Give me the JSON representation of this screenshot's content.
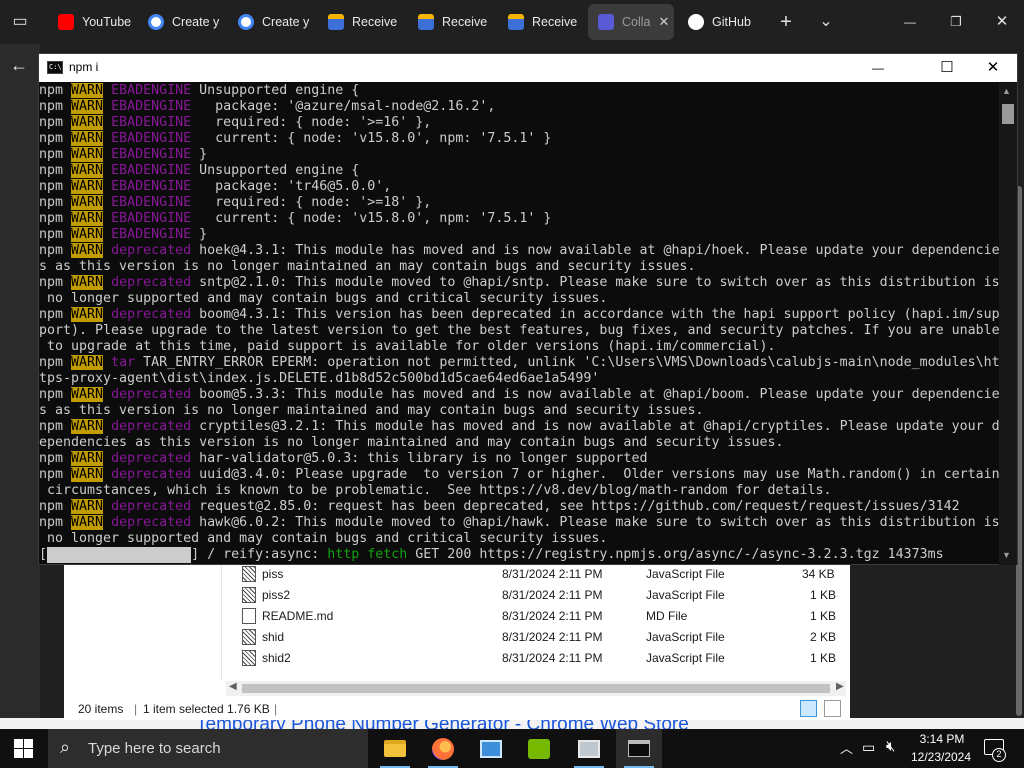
{
  "browser": {
    "tabs": [
      {
        "label": "YouTube",
        "icon": "youtube-icon"
      },
      {
        "label": "Create y",
        "icon": "google-icon"
      },
      {
        "label": "Create y",
        "icon": "google-icon"
      },
      {
        "label": "Receive",
        "icon": "receive-icon"
      },
      {
        "label": "Receive",
        "icon": "receive-icon"
      },
      {
        "label": "Receive",
        "icon": "receive-icon"
      },
      {
        "label": "Colla",
        "icon": "collab-icon",
        "active": true
      },
      {
        "label": "GitHub",
        "icon": "github-icon"
      }
    ],
    "new_tab_glyph": "+",
    "tab_list_glyph": "⌄",
    "minimize_glyph": "—",
    "restore_glyph": "❐",
    "close_glyph": "✕",
    "back_glyph": "←",
    "page_bottom_text": "Temporary Phone Number Generator - Chrome Web Store"
  },
  "terminal": {
    "title": "npm i",
    "icon_text": "C:\\",
    "minimize_glyph": "—",
    "maximize_glyph": "☐",
    "close_glyph": "✕",
    "lines": [
      [
        {
          "t": "npm "
        },
        {
          "t": "WARN",
          "c": "warn"
        },
        {
          "t": " "
        },
        {
          "t": "EBADENGINE",
          "c": "magenta"
        },
        {
          "t": " Unsupported engine {"
        }
      ],
      [
        {
          "t": "npm "
        },
        {
          "t": "WARN",
          "c": "warn"
        },
        {
          "t": " "
        },
        {
          "t": "EBADENGINE",
          "c": "magenta"
        },
        {
          "t": "   package: '@azure/msal-node@2.16.2',"
        }
      ],
      [
        {
          "t": "npm "
        },
        {
          "t": "WARN",
          "c": "warn"
        },
        {
          "t": " "
        },
        {
          "t": "EBADENGINE",
          "c": "magenta"
        },
        {
          "t": "   required: { node: '>=16' },"
        }
      ],
      [
        {
          "t": "npm "
        },
        {
          "t": "WARN",
          "c": "warn"
        },
        {
          "t": " "
        },
        {
          "t": "EBADENGINE",
          "c": "magenta"
        },
        {
          "t": "   current: { node: 'v15.8.0', npm: '7.5.1' }"
        }
      ],
      [
        {
          "t": "npm "
        },
        {
          "t": "WARN",
          "c": "warn"
        },
        {
          "t": " "
        },
        {
          "t": "EBADENGINE",
          "c": "magenta"
        },
        {
          "t": " }"
        }
      ],
      [
        {
          "t": "npm "
        },
        {
          "t": "WARN",
          "c": "warn"
        },
        {
          "t": " "
        },
        {
          "t": "EBADENGINE",
          "c": "magenta"
        },
        {
          "t": " Unsupported engine {"
        }
      ],
      [
        {
          "t": "npm "
        },
        {
          "t": "WARN",
          "c": "warn"
        },
        {
          "t": " "
        },
        {
          "t": "EBADENGINE",
          "c": "magenta"
        },
        {
          "t": "   package: 'tr46@5.0.0',"
        }
      ],
      [
        {
          "t": "npm "
        },
        {
          "t": "WARN",
          "c": "warn"
        },
        {
          "t": " "
        },
        {
          "t": "EBADENGINE",
          "c": "magenta"
        },
        {
          "t": "   required: { node: '>=18' },"
        }
      ],
      [
        {
          "t": "npm "
        },
        {
          "t": "WARN",
          "c": "warn"
        },
        {
          "t": " "
        },
        {
          "t": "EBADENGINE",
          "c": "magenta"
        },
        {
          "t": "   current: { node: 'v15.8.0', npm: '7.5.1' }"
        }
      ],
      [
        {
          "t": "npm "
        },
        {
          "t": "WARN",
          "c": "warn"
        },
        {
          "t": " "
        },
        {
          "t": "EBADENGINE",
          "c": "magenta"
        },
        {
          "t": " }"
        }
      ],
      [
        {
          "t": "npm "
        },
        {
          "t": "WARN",
          "c": "warn"
        },
        {
          "t": " "
        },
        {
          "t": "deprecated",
          "c": "magenta"
        },
        {
          "t": " hoek@4.3.1: This module has moved and is now available at @hapi/hoek. Please update your dependencie"
        }
      ],
      [
        {
          "t": "s as this version is no longer maintained an may contain bugs and security issues."
        }
      ],
      [
        {
          "t": "npm "
        },
        {
          "t": "WARN",
          "c": "warn"
        },
        {
          "t": " "
        },
        {
          "t": "deprecated",
          "c": "magenta"
        },
        {
          "t": " sntp@2.1.0: This module moved to @hapi/sntp. Please make sure to switch over as this distribution is"
        }
      ],
      [
        {
          "t": " no longer supported and may contain bugs and critical security issues."
        }
      ],
      [
        {
          "t": "npm "
        },
        {
          "t": "WARN",
          "c": "warn"
        },
        {
          "t": " "
        },
        {
          "t": "deprecated",
          "c": "magenta"
        },
        {
          "t": " boom@4.3.1: This version has been deprecated in accordance with the hapi support policy (hapi.im/sup"
        }
      ],
      [
        {
          "t": "port). Please upgrade to the latest version to get the best features, bug fixes, and security patches. If you are unable"
        }
      ],
      [
        {
          "t": " to upgrade at this time, paid support is available for older versions (hapi.im/commercial)."
        }
      ],
      [
        {
          "t": "npm "
        },
        {
          "t": "WARN",
          "c": "warn"
        },
        {
          "t": " "
        },
        {
          "t": "tar",
          "c": "magenta"
        },
        {
          "t": " TAR_ENTRY_ERROR EPERM: operation not permitted, unlink 'C:\\Users\\VMS\\Downloads\\calubjs-main\\node_modules\\ht"
        }
      ],
      [
        {
          "t": "tps-proxy-agent\\dist\\index.js.DELETE.d1b8d52c500bd1d5cae64ed6ae1a5499'"
        }
      ],
      [
        {
          "t": "npm "
        },
        {
          "t": "WARN",
          "c": "warn"
        },
        {
          "t": " "
        },
        {
          "t": "deprecated",
          "c": "magenta"
        },
        {
          "t": " boom@5.3.3: This module has moved and is now available at @hapi/boom. Please update your dependencie"
        }
      ],
      [
        {
          "t": "s as this version is no longer maintained and may contain bugs and security issues."
        }
      ],
      [
        {
          "t": "npm "
        },
        {
          "t": "WARN",
          "c": "warn"
        },
        {
          "t": " "
        },
        {
          "t": "deprecated",
          "c": "magenta"
        },
        {
          "t": " cryptiles@3.2.1: This module has moved and is now available at @hapi/cryptiles. Please update your d"
        }
      ],
      [
        {
          "t": "ependencies as this version is no longer maintained and may contain bugs and security issues."
        }
      ],
      [
        {
          "t": "npm "
        },
        {
          "t": "WARN",
          "c": "warn"
        },
        {
          "t": " "
        },
        {
          "t": "deprecated",
          "c": "magenta"
        },
        {
          "t": " har-validator@5.0.3: this library is no longer supported"
        }
      ],
      [
        {
          "t": "npm "
        },
        {
          "t": "WARN",
          "c": "warn"
        },
        {
          "t": " "
        },
        {
          "t": "deprecated",
          "c": "magenta"
        },
        {
          "t": " uuid@3.4.0: Please upgrade  to version 7 or higher.  Older versions may use Math.random() in certain"
        }
      ],
      [
        {
          "t": " circumstances, which is known to be problematic.  See https://v8.dev/blog/math-random for details."
        }
      ],
      [
        {
          "t": "npm "
        },
        {
          "t": "WARN",
          "c": "warn"
        },
        {
          "t": " "
        },
        {
          "t": "deprecated",
          "c": "magenta"
        },
        {
          "t": " request@2.85.0: request has been deprecated, see https://github.com/request/request/issues/3142"
        }
      ],
      [
        {
          "t": "npm "
        },
        {
          "t": "WARN",
          "c": "warn"
        },
        {
          "t": " "
        },
        {
          "t": "deprecated",
          "c": "magenta"
        },
        {
          "t": " hawk@6.0.2: This module moved to @hapi/hawk. Please make sure to switch over as this distribution is"
        }
      ],
      [
        {
          "t": " no longer supported and may contain bugs and critical security issues."
        }
      ],
      [
        {
          "t": "["
        },
        {
          "t": "                  ",
          "c": "progress"
        },
        {
          "t": "] / reify:async: "
        },
        {
          "t": "http fetch",
          "c": "green"
        },
        {
          "t": " GET 200 https://registry.npmjs.org/async/-/async-3.2.3.tgz 14373ms"
        }
      ]
    ]
  },
  "explorer": {
    "files": [
      {
        "name": "piss",
        "date": "8/31/2024 2:11 PM",
        "type": "JavaScript File",
        "size": "34 KB",
        "icon": "js-file-icon"
      },
      {
        "name": "piss2",
        "date": "8/31/2024 2:11 PM",
        "type": "JavaScript File",
        "size": "1 KB",
        "icon": "js-file-icon"
      },
      {
        "name": "README.md",
        "date": "8/31/2024 2:11 PM",
        "type": "MD File",
        "size": "1 KB",
        "icon": "md-file-icon"
      },
      {
        "name": "shid",
        "date": "8/31/2024 2:11 PM",
        "type": "JavaScript File",
        "size": "2 KB",
        "icon": "js-file-icon"
      },
      {
        "name": "shid2",
        "date": "8/31/2024 2:11 PM",
        "type": "JavaScript File",
        "size": "1 KB",
        "icon": "js-file-icon"
      }
    ],
    "status": {
      "item_count": "20 items",
      "selection": "1 item selected  1.76 KB"
    }
  },
  "taskbar": {
    "search_placeholder": "Type here to search",
    "apps": [
      "file-explorer-icon",
      "firefox-icon",
      "control-panel-icon",
      "nvidia-icon",
      "photos-icon",
      "terminal-icon"
    ],
    "time": "3:14 PM",
    "date": "12/23/2024",
    "notification_count": "2"
  },
  "colors": {
    "terminal_bg": "#0c0c0c",
    "warn_bg": "#c19c00",
    "magenta": "#881798",
    "green": "#13a10e"
  }
}
